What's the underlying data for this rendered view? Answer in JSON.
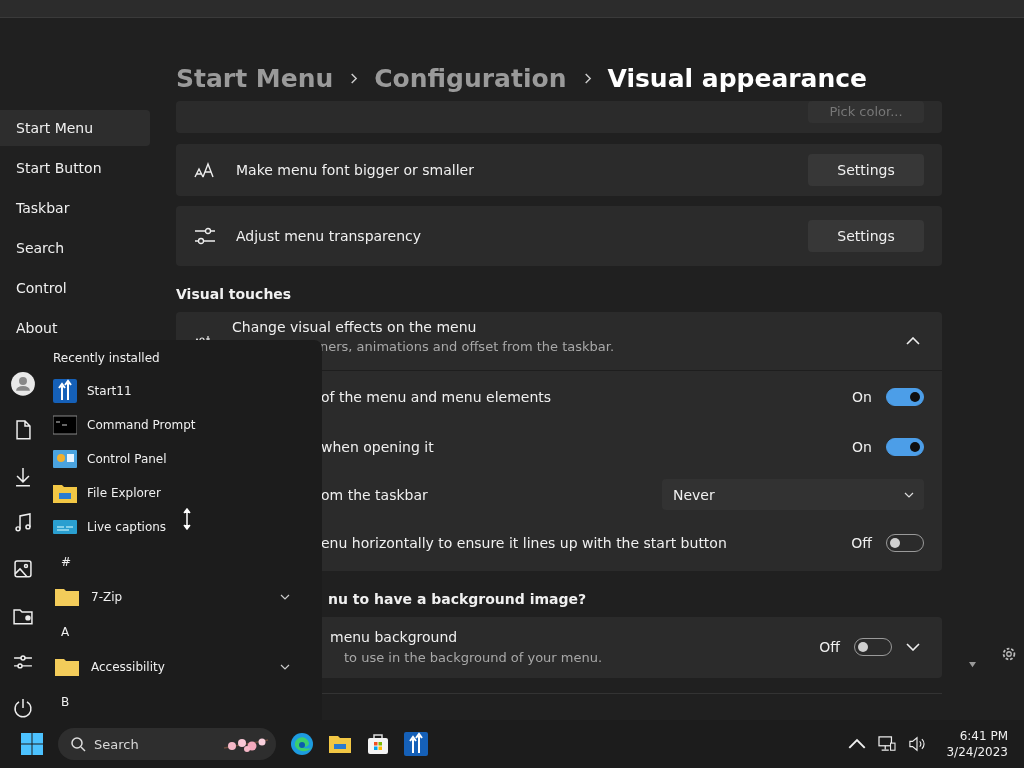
{
  "nav": [
    {
      "label": "Start Menu",
      "selected": true
    },
    {
      "label": "Start Button",
      "selected": false
    },
    {
      "label": "Taskbar",
      "selected": false
    },
    {
      "label": "Search",
      "selected": false
    },
    {
      "label": "Control",
      "selected": false
    },
    {
      "label": "About",
      "selected": false
    }
  ],
  "breadcrumb": [
    "Start Menu",
    "Configuration",
    "Visual appearance"
  ],
  "color_row": {
    "button": "Pick color..."
  },
  "setting_rows": [
    {
      "label": "Make menu font bigger or smaller",
      "button": "Settings"
    },
    {
      "label": "Adjust menu transparency",
      "button": "Settings"
    }
  ],
  "visual_touches": {
    "heading": "Visual touches",
    "expander": {
      "title": "Change visual effects on the menu",
      "subtitle": "ners, animations and offset from the taskbar.",
      "expanded": true,
      "rows": [
        {
          "kind": "toggle",
          "label": "of the menu and menu elements",
          "state": "On",
          "on": true
        },
        {
          "kind": "toggle",
          "label": "when opening it",
          "state": "On",
          "on": true
        },
        {
          "kind": "dropdown",
          "label": "om the taskbar",
          "value": "Never"
        },
        {
          "kind": "toggle",
          "label": "enu horizontally to ensure it lines up with the start button",
          "state": "Off",
          "on": false
        }
      ]
    }
  },
  "background_section": {
    "heading": "nu to have a background image?",
    "card": {
      "title": "menu background",
      "subtitle": "to use in the background of your menu.",
      "state": "Off",
      "on": false,
      "expanded": false
    }
  },
  "start_menu": {
    "heading": "Recently installed",
    "apps": [
      {
        "name": "Start11"
      },
      {
        "name": "Command Prompt"
      },
      {
        "name": "Control Panel"
      },
      {
        "name": "File Explorer"
      },
      {
        "name": "Live captions"
      }
    ],
    "groups": [
      {
        "letter": "#",
        "folders": [
          {
            "name": "7-Zip"
          }
        ]
      },
      {
        "letter": "A",
        "folders": [
          {
            "name": "Accessibility"
          }
        ]
      },
      {
        "letter": "B"
      }
    ]
  },
  "taskbar": {
    "search_placeholder": "Search",
    "time": "6:41 PM",
    "date": "3/24/2023"
  }
}
